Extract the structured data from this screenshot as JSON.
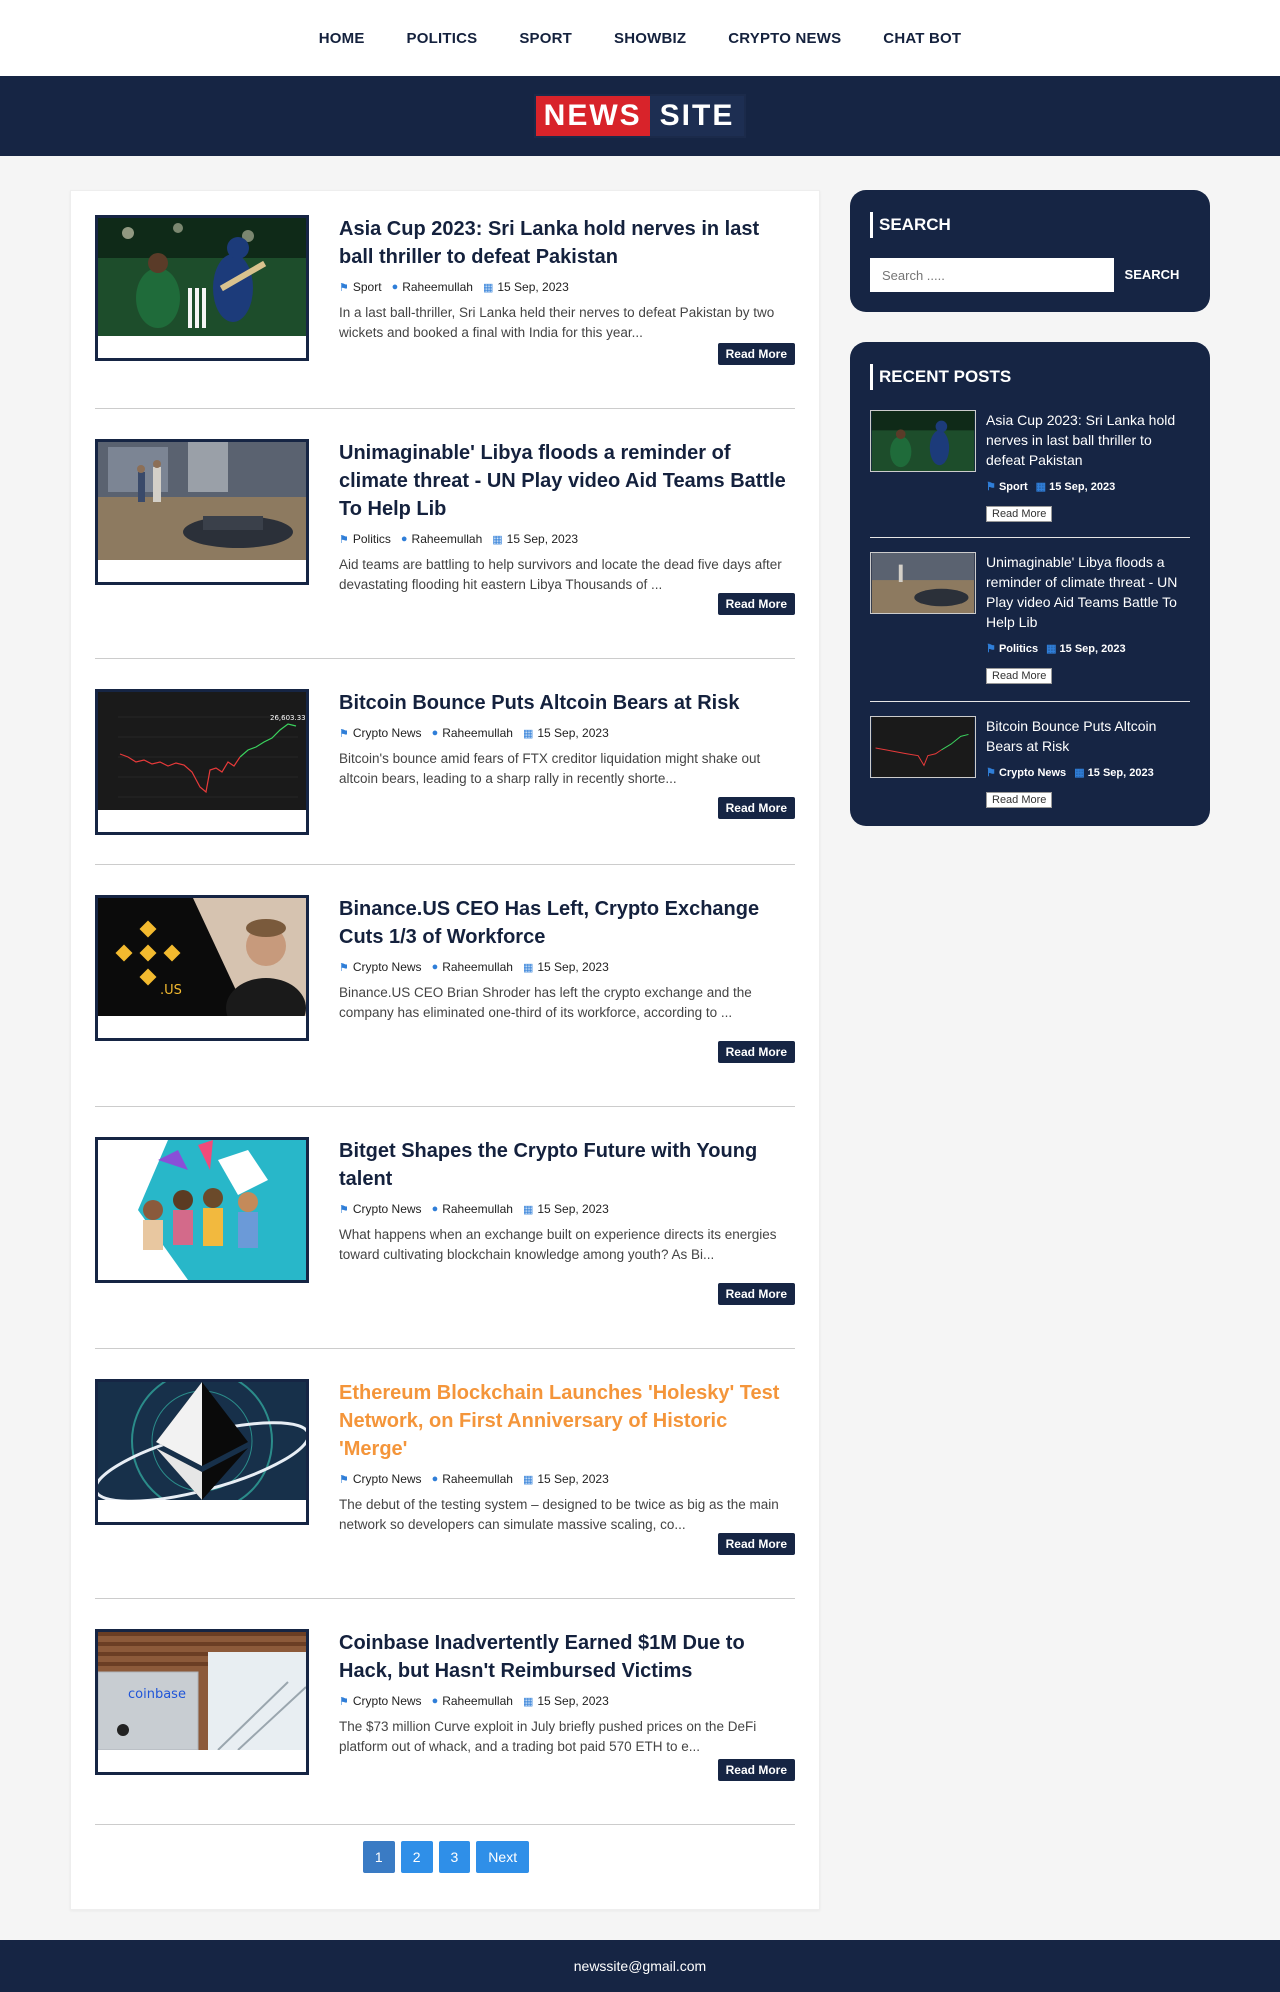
{
  "nav": [
    "HOME",
    "POLITICS",
    "SPORT",
    "SHOWBIZ",
    "CRYPTO NEWS",
    "CHAT BOT"
  ],
  "logo": {
    "word1": "NEWS",
    "word2": "SITE",
    "accent": "#d8232a",
    "bg": "#162544"
  },
  "posts": [
    {
      "title": "Asia Cup 2023: Sri Lanka hold nerves in last ball thriller to defeat Pakistan",
      "category": "Sport",
      "author": "Raheemullah",
      "date": "15 Sep, 2023",
      "excerpt": "In a last ball-thriller, Sri Lanka held their nerves to defeat Pakistan by two wickets and booked a final with India for this year...",
      "read_more": "Read More",
      "image": "cricket-photo"
    },
    {
      "title": "Unimaginable' Libya floods a reminder of climate threat - UN Play video Aid Teams Battle To Help Lib",
      "category": "Politics",
      "author": "Raheemullah",
      "date": "15 Sep, 2023",
      "excerpt": "Aid teams are battling to help survivors and locate the dead five days after devastating flooding hit eastern Libya Thousands of ...",
      "read_more": "Read More",
      "image": "flood-photo"
    },
    {
      "title": "Bitcoin Bounce Puts Altcoin Bears at Risk",
      "category": "Crypto News",
      "author": "Raheemullah",
      "date": "15 Sep, 2023",
      "excerpt": "Bitcoin's bounce amid fears of FTX creditor liquidation might shake out altcoin bears, leading to a sharp rally in recently shorte...",
      "read_more": "Read More",
      "image": "btc-chart"
    },
    {
      "title": "Binance.US CEO Has Left, Crypto Exchange Cuts 1/3 of Workforce",
      "category": "Crypto News",
      "author": "Raheemullah",
      "date": "15 Sep, 2023",
      "excerpt": "Binance.US CEO Brian Shroder has left the crypto exchange and the company has eliminated one-third of its workforce, according to ...",
      "read_more": "Read More",
      "image": "binance-us"
    },
    {
      "title": "Bitget Shapes the Crypto Future with Young talent",
      "category": "Crypto News",
      "author": "Raheemullah",
      "date": "15 Sep, 2023",
      "excerpt": "What happens when an exchange built on experience directs its energies toward cultivating blockchain knowledge among youth? As Bi...",
      "read_more": "Read More",
      "image": "bitget-youth"
    },
    {
      "title": "Ethereum Blockchain Launches 'Holesky' Test Network, on First Anniversary of Historic 'Merge'",
      "category": "Crypto News",
      "author": "Raheemullah",
      "date": "15 Sep, 2023",
      "excerpt": "The debut of the testing system – designed to be twice as big as the main network so developers can simulate massive scaling, co...",
      "read_more": "Read More",
      "image": "ethereum-logo"
    },
    {
      "title": "Coinbase Inadvertently Earned $1M Due to Hack, but Hasn't Reimbursed Victims",
      "category": "Crypto News",
      "author": "Raheemullah",
      "date": "15 Sep, 2023",
      "excerpt": "The $73 million Curve exploit in July briefly pushed prices on the DeFi platform out of whack, and a trading bot paid 570 ETH to e...",
      "read_more": "Read More",
      "image": "coinbase-laptop"
    }
  ],
  "pagination": [
    "1",
    "2",
    "3",
    "Next"
  ],
  "sidebar": {
    "search_title": "SEARCH",
    "search_placeholder": "Search .....",
    "search_button": "SEARCH",
    "recent_title": "RECENT POSTS",
    "recent": [
      {
        "title": "Asia Cup 2023: Sri Lanka hold nerves in last ball thriller to defeat Pakistan",
        "category": "Sport",
        "date": "15 Sep, 2023",
        "read_more": "Read More"
      },
      {
        "title": "Unimaginable' Libya floods a reminder of climate threat - UN Play video Aid Teams Battle To Help Lib",
        "category": "Politics",
        "date": "15 Sep, 2023",
        "read_more": "Read More"
      },
      {
        "title": "Bitcoin Bounce Puts Altcoin Bears at Risk",
        "category": "Crypto News",
        "date": "15 Sep, 2023",
        "read_more": "Read More"
      }
    ]
  },
  "btc_chart_label": "26,603.33",
  "binance_label": ".US",
  "coinbase_label": "coinbase",
  "footer": "newssite@gmail.com"
}
